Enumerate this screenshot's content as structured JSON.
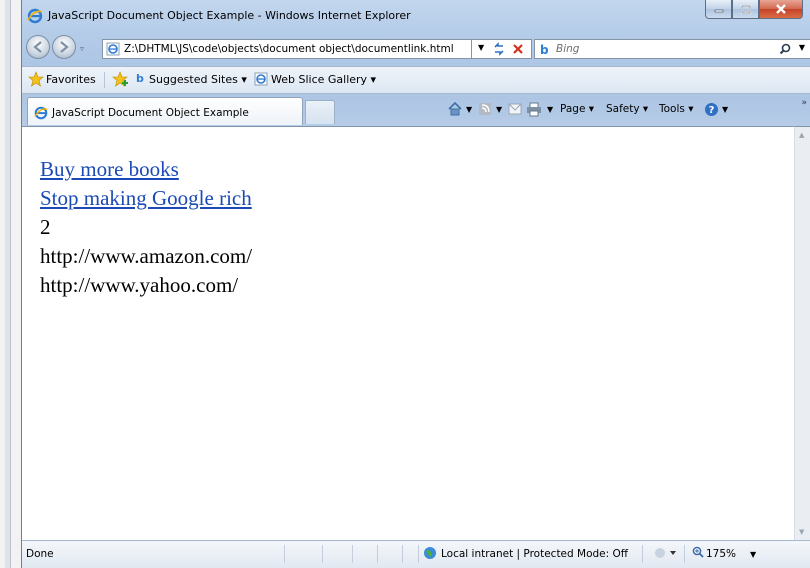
{
  "window": {
    "title": "JavaScript Document Object Example - Windows Internet Explorer"
  },
  "address_bar": {
    "url": "Z:\\DHTML\\JS\\code\\objects\\document object\\documentlink.html"
  },
  "search": {
    "placeholder": "Bing"
  },
  "favorites_bar": {
    "favorites_label": "Favorites",
    "suggested_sites_label": "Suggested Sites ▾",
    "web_slice_label": "Web Slice Gallery ▾"
  },
  "tab": {
    "label": "JavaScript Document Object Example"
  },
  "command_bar": {
    "page_label": "Page ▾",
    "safety_label": "Safety ▾",
    "tools_label": "Tools ▾"
  },
  "content": {
    "links": [
      "Buy more books",
      "Stop making Google rich"
    ],
    "lines": [
      "2",
      "http://www.amazon.com/",
      "http://www.yahoo.com/"
    ]
  },
  "status_bar": {
    "status_text": "Done",
    "zone_text": "Local intranet | Protected Mode: Off",
    "zoom_text": "175%"
  },
  "colors": {
    "link": "#1b49b5",
    "chrome": "#b6cde9",
    "close_button": "#c44127"
  },
  "icons": [
    "ie-logo-icon",
    "minimize-icon",
    "maximize-icon",
    "close-icon",
    "back-icon",
    "forward-icon",
    "page-icon",
    "refresh-icon",
    "stop-icon",
    "bing-icon",
    "search-icon",
    "favorites-star-icon",
    "add-favorites-icon",
    "home-icon",
    "feeds-icon",
    "mail-icon",
    "print-icon",
    "help-icon",
    "zone-globe-icon"
  ]
}
